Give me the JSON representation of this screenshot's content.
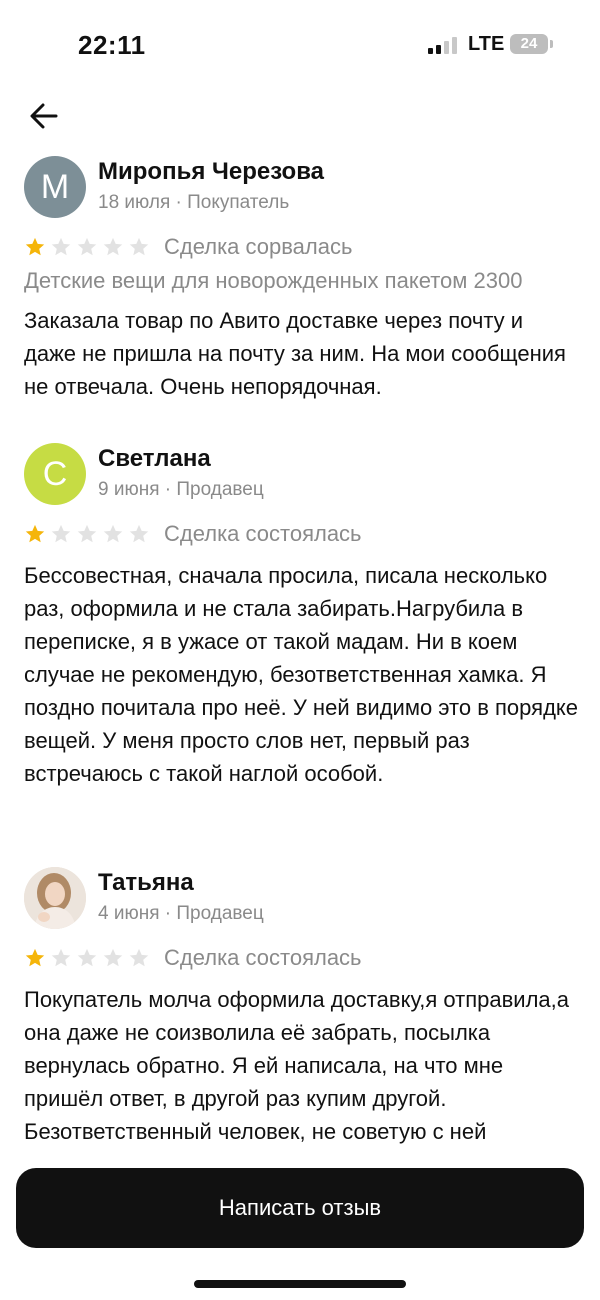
{
  "status_bar": {
    "time": "22:11",
    "network": "LTE",
    "battery": "24"
  },
  "icons": {
    "back": "arrow-left-icon",
    "star_filled": "star-filled-icon",
    "star_empty": "star-empty-icon"
  },
  "colors": {
    "star_filled": "#f5b50a",
    "star_empty": "#e2e2e2",
    "button_bg": "#111111",
    "meta_text": "#8a8a8a"
  },
  "reviews": [
    {
      "avatar_letter": "M",
      "avatar_color": "#7d8f97",
      "name": "Миропья Черезова",
      "meta": "18 июля · Покупатель",
      "rating": 1,
      "deal_status": "Сделка сорвалась",
      "item_title": "Детские вещи для новорожденных пакетом 2300",
      "text": "Заказала товар по Авито доставке через почту и даже не пришла на почту за ним. На мои сообщения не отвечала. Очень непорядочная."
    },
    {
      "avatar_letter": "C",
      "avatar_color": "#c6dc44",
      "name": "Светлана",
      "meta": "9 июня · Продавец",
      "rating": 1,
      "deal_status": "Сделка состоялась",
      "text": "Бессовестная, сначала просила, писала несколько раз, оформила и не стала забирать.Нагрубила в переписке, я в ужасе от такой мадам. Ни в коем случае не рекомендую, безответственная хамка. Я поздно почитала про неё. У ней видимо это в порядке вещей. У меня просто слов нет, первый раз встречаюсь с такой наглой особой."
    },
    {
      "avatar_letter": "",
      "avatar_color": "#e9ddd2",
      "name": "Татьяна",
      "meta": "4 июня · Продавец",
      "rating": 1,
      "deal_status": "Сделка состоялась",
      "text": "Покупатель молча оформила доставку,я отправила,а она даже не соизволила её забрать, посылка вернулась обратно. Я ей написала, на что мне пришёл ответ, в другой раз купим другой. Безответственный человек, не советую с ней"
    }
  ],
  "write_review_label": "Написать отзыв"
}
